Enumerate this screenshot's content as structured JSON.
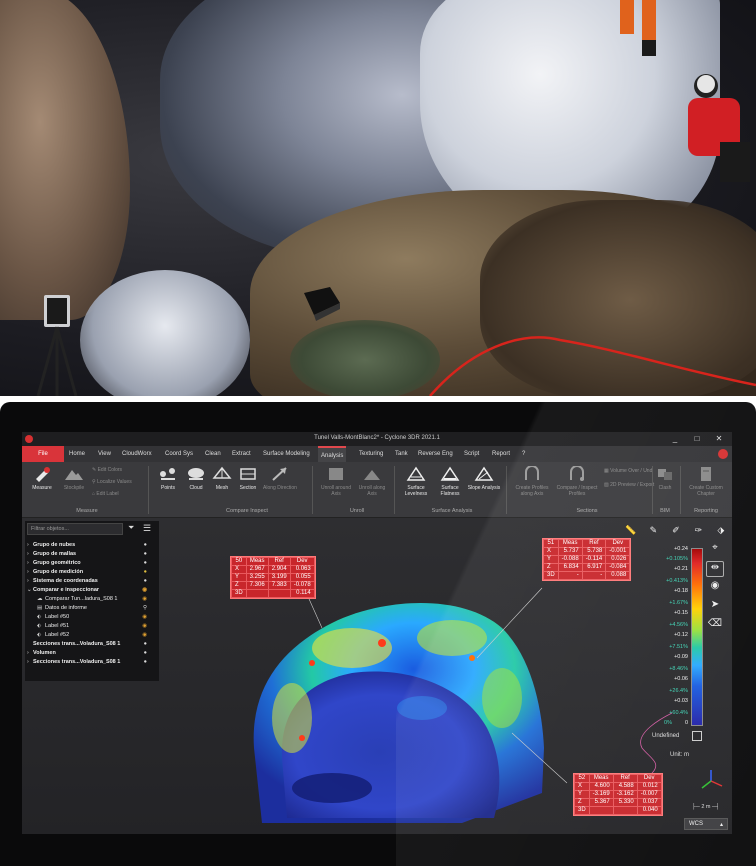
{
  "window": {
    "title": "Tunel Valls-MontBlanc2* - Cyclone 3DR 2021.1",
    "minimize": "_",
    "maximize": "□",
    "close": "✕"
  },
  "menu": {
    "file": "File",
    "items": [
      "Home",
      "View",
      "CloudWorx",
      "Coord Sys",
      "Clean",
      "Extract",
      "Surface Modeling",
      "Analysis",
      "Texturing",
      "Tank",
      "Reverse Eng",
      "Script",
      "Report",
      "?"
    ],
    "active": "Analysis"
  },
  "ribbon": {
    "measure": {
      "measure": "Measure",
      "stockpile": "Stockpile",
      "edit_colors": "Edit Colors",
      "localize_values": "Localize Values",
      "edit_label": "Edit Label",
      "group": "Measure"
    },
    "compare": {
      "points": "Points",
      "cloud": "Cloud",
      "mesh": "Mesh",
      "section": "Section",
      "along_direction": "Along Direction",
      "group": "Compare Inspect"
    },
    "unroll": {
      "unroll_around_axis": "Unroll around Axis",
      "unroll_along_axis": "Unroll along Axis",
      "group": "Unroll"
    },
    "surface": {
      "levelness": "Surface Levelness",
      "flatness": "Surface Flatness",
      "slope": "Slope Analysis",
      "group": "Surface Analysis"
    },
    "sections": {
      "create_profiles": "Create Profiles along Axis",
      "compare_profiles": "Compare / Inspect Profiles",
      "volume_over": "Volume Over / Und",
      "preview_export": "2D Preview / Export",
      "group": "Sections"
    },
    "bim": {
      "clash": "Clash",
      "group": "BIM"
    },
    "reporting": {
      "create_custom_chapter": "Create Custom Chapter",
      "group": "Reporting"
    }
  },
  "tree": {
    "filter_placeholder": "Filtrar objetos...",
    "rows": [
      {
        "label": "Grupo de nubes",
        "bold": true
      },
      {
        "label": "Grupo de mallas",
        "bold": true
      },
      {
        "label": "Grupo geométrico",
        "bold": true
      },
      {
        "label": "Grupo de medición",
        "bold": true
      },
      {
        "label": "Sistema de coordenadas",
        "bold": true
      },
      {
        "label": "Comparar e inspeccionar",
        "bold": true
      },
      {
        "label": "Comparar Tun...ladura_S08 1",
        "bold": false
      },
      {
        "label": "Datos de informe",
        "bold": false
      },
      {
        "label": "Label #50",
        "bold": false
      },
      {
        "label": "Label #51",
        "bold": false
      },
      {
        "label": "Label #52",
        "bold": false
      },
      {
        "label": "Secciones trans...Voladura_S08 1",
        "bold": true
      },
      {
        "label": "Volumen",
        "bold": true
      },
      {
        "label": "Secciones trans...Voladura_S08 1",
        "bold": true
      }
    ]
  },
  "labels": [
    {
      "id": "50",
      "headers": [
        "Meas",
        "Ref",
        "Dev"
      ],
      "rows": [
        [
          "X",
          "2.967",
          "2.904",
          "0.063"
        ],
        [
          "Y",
          "3.255",
          "3.199",
          "0.055"
        ],
        [
          "Z",
          "7.306",
          "7.383",
          "-0.078"
        ],
        [
          "3D",
          "",
          "",
          "0.114"
        ]
      ]
    },
    {
      "id": "51",
      "headers": [
        "Meas",
        "Ref",
        "Dev"
      ],
      "rows": [
        [
          "X",
          "5.737",
          "5.738",
          "-0.001"
        ],
        [
          "Y",
          "-0.088",
          "-0.114",
          "0.026"
        ],
        [
          "Z",
          "6.834",
          "6.917",
          "-0.084"
        ],
        [
          "3D",
          "-",
          "-",
          "0.088"
        ]
      ]
    },
    {
      "id": "52",
      "headers": [
        "Meas",
        "Ref",
        "Dev"
      ],
      "rows": [
        [
          "X",
          "4.600",
          "4.588",
          "0.012"
        ],
        [
          "Y",
          "-3.169",
          "-3.162",
          "-0.007"
        ],
        [
          "Z",
          "5.367",
          "5.330",
          "0.037"
        ],
        [
          "3D",
          "",
          "",
          "0.040"
        ]
      ]
    }
  ],
  "scale": {
    "values": [
      "+0.24",
      "+0.21",
      "+0.18",
      "+0.15",
      "+0.12",
      "+0.09",
      "+0.06",
      "+0.03",
      "0"
    ],
    "percents": [
      "+0.105%",
      "+0.413%",
      "+1.67%",
      "+4.56%",
      "+7.51%",
      "+8.46%",
      "+26.4%",
      "+60.4%",
      "0%"
    ],
    "undefined": "Undefined",
    "unit": "Unit: m",
    "scale_bar": "2 m",
    "coord_system": "WCS"
  }
}
